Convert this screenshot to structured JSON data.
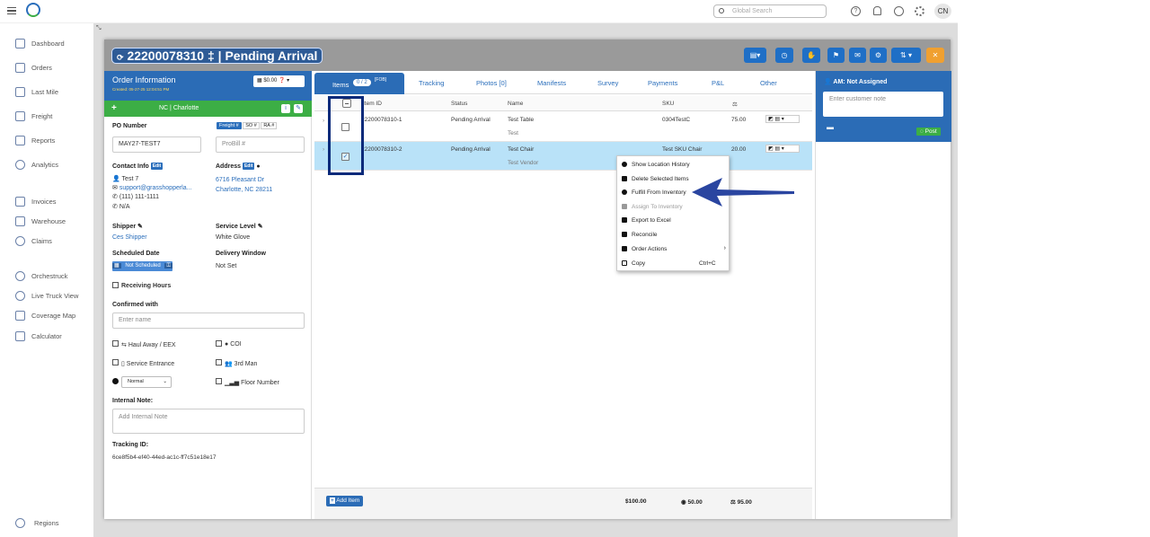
{
  "topbar": {
    "search_placeholder": "Global Search",
    "avatar": "CN"
  },
  "nav": {
    "items": [
      {
        "label": "Dashboard"
      },
      {
        "label": "Orders"
      },
      {
        "label": "Last Mile"
      },
      {
        "label": "Freight"
      },
      {
        "label": "Reports"
      },
      {
        "label": "Analytics"
      },
      {
        "label": "Invoices"
      },
      {
        "label": "Warehouse"
      },
      {
        "label": "Claims"
      },
      {
        "label": "Orchestruck"
      },
      {
        "label": "Live Truck View"
      },
      {
        "label": "Coverage Map"
      },
      {
        "label": "Calculator"
      },
      {
        "label": "Regions"
      }
    ]
  },
  "header": {
    "title": "22200078310 ‡ | Pending Arrival",
    "refresh_icon": "⟳"
  },
  "order": {
    "title": "Order Information",
    "created": "Created: 05-27-25 12:04:51 PM",
    "amount": "$0.00",
    "location": "NC | Charlotte",
    "po_label": "PO Number",
    "po_value": "MAY27-TEST7",
    "freight_btn": "Freight #",
    "so_btn": "SO #",
    "ra_btn": "RA #",
    "probill_placeholder": "ProBill #",
    "contact_label": "Contact Info",
    "edit": "Edit",
    "contact_name": "Test 7",
    "contact_email": "support@grasshopperla...",
    "contact_phone": "(111) 111-1111",
    "contact_alt": "N/A",
    "address_label": "Address",
    "address_line1": "6716 Pleasant Dr",
    "address_line2": "Charlotte, NC 28211",
    "shipper_label": "Shipper",
    "shipper_value": "Ces Shipper",
    "service_label": "Service Level",
    "service_value": "White Glove",
    "sched_label": "Scheduled Date",
    "sched_value": "Not Scheduled",
    "window_label": "Delivery Window",
    "window_value": "Not Set",
    "receiving_hours": "Receiving Hours",
    "confirmed_label": "Confirmed with",
    "confirmed_placeholder": "Enter name",
    "haul_away": "Haul Away / EEX",
    "coi": "COI",
    "service_entrance": "Service Entrance",
    "third_man": "3rd Man",
    "priority": "Normal",
    "floor_number": "Floor Number",
    "internal_note_label": "Internal Note:",
    "internal_note_placeholder": "Add Internal Note",
    "tracking_label": "Tracking ID:",
    "tracking_value": "6ce8f5b4-ef40-44ed-ac1c-ff7c51e18e17"
  },
  "tabs": {
    "items_label": "Items",
    "items_badge": "0 / 2",
    "items_fob": "[FOB]",
    "tracking": "Tracking",
    "photos": "Photos [0]",
    "manifests": "Manifests",
    "survey": "Survey",
    "payments": "Payments",
    "pl": "P&L",
    "other": "Other"
  },
  "grid": {
    "headers": {
      "item_id": "Item ID",
      "status": "Status",
      "name": "Name",
      "sku": "SKU"
    },
    "rows": [
      {
        "item_id": "22200078310-1",
        "status": "Pending Arrival",
        "name": "Test Table",
        "sub": "Test",
        "sku": "0304TestC",
        "value": "75.00"
      },
      {
        "item_id": "22200078310-2",
        "status": "Pending Arrival",
        "name": "Test Chair",
        "sub": "Test Vendor",
        "sku": "Test SKU Chair",
        "value": "20.00"
      }
    ],
    "add_item": "Add Item",
    "total": "$100.00",
    "total2": "50.00",
    "total3": "95.00"
  },
  "right": {
    "am": "AM: Not Assigned",
    "note_placeholder": "Enter customer note",
    "post": "Post"
  },
  "context_menu": [
    {
      "label": "Show Location History",
      "disabled": false
    },
    {
      "label": "Delete Selected Items",
      "disabled": false
    },
    {
      "label": "Fulfill From Inventory",
      "disabled": false
    },
    {
      "label": "Assign To Inventory",
      "disabled": true
    },
    {
      "label": "Export to Excel",
      "disabled": false
    },
    {
      "label": "Reconcile",
      "disabled": false
    },
    {
      "label": "Order Actions",
      "disabled": false
    },
    {
      "label": "Copy",
      "shortcut": "Ctrl+C",
      "disabled": false
    }
  ],
  "colors": {
    "primary": "#2b6cb6",
    "green": "#3cae45",
    "orange": "#f0a030",
    "highlight_row": "#b9e2f8",
    "arrow": "#2a45a0"
  }
}
